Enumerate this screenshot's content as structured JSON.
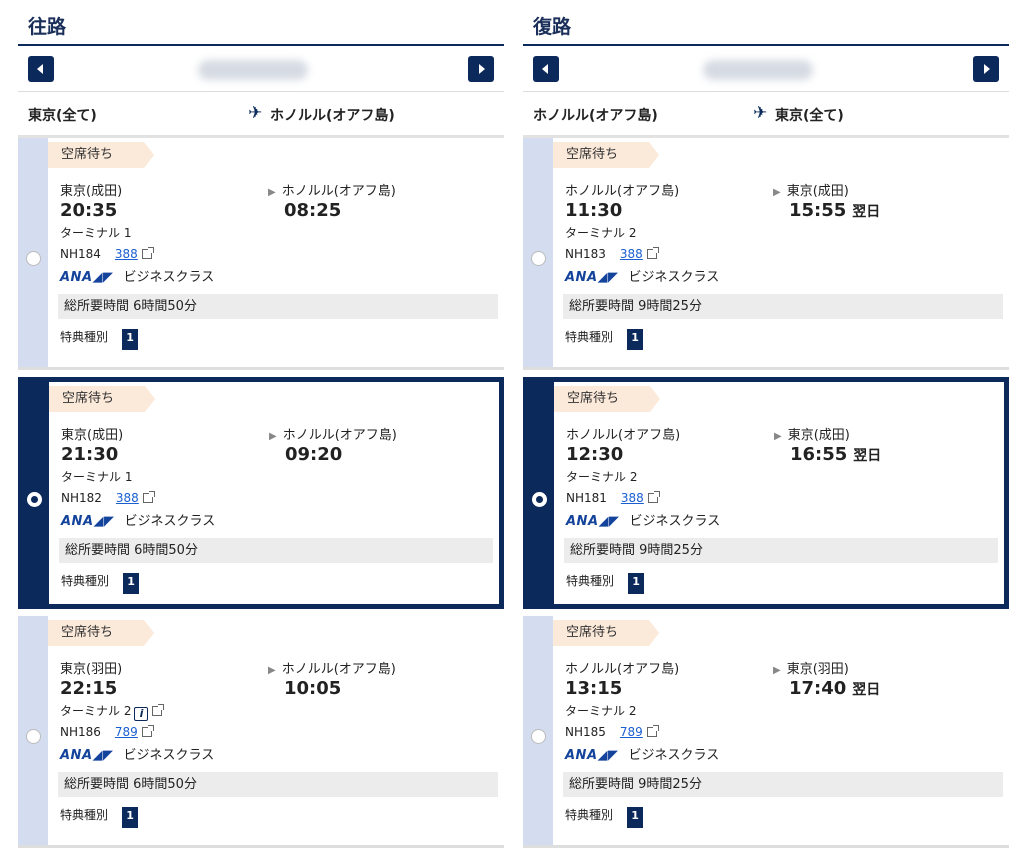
{
  "outbound": {
    "title": "往路",
    "route": {
      "from": "東京(全て)",
      "to": "ホノルル(オアフ島)"
    },
    "flights": [
      {
        "status": "空席待ち",
        "dep_city": "東京(成田)",
        "dep_time": "20:35",
        "arr_city": "ホノルル(オアフ島)",
        "arr_time": "08:25",
        "next_day": "",
        "terminal": "ターミナル 1",
        "flight_no": "NH184",
        "aircraft": "388",
        "cabin": "ビジネスクラス",
        "duration": "総所要時間 6時間50分",
        "award_label": "特典種別",
        "award_value": "1",
        "selected": false
      },
      {
        "status": "空席待ち",
        "dep_city": "東京(成田)",
        "dep_time": "21:30",
        "arr_city": "ホノルル(オアフ島)",
        "arr_time": "09:20",
        "next_day": "",
        "terminal": "ターミナル 1",
        "flight_no": "NH182",
        "aircraft": "388",
        "cabin": "ビジネスクラス",
        "duration": "総所要時間 6時間50分",
        "award_label": "特典種別",
        "award_value": "1",
        "selected": true
      },
      {
        "status": "空席待ち",
        "dep_city": "東京(羽田)",
        "dep_time": "22:15",
        "arr_city": "ホノルル(オアフ島)",
        "arr_time": "10:05",
        "next_day": "",
        "terminal": "ターミナル 2",
        "flight_no": "NH186",
        "aircraft": "789",
        "cabin": "ビジネスクラス",
        "duration": "総所要時間 6時間50分",
        "award_label": "特典種別",
        "award_value": "1",
        "selected": false
      }
    ]
  },
  "return": {
    "title": "復路",
    "route": {
      "from": "ホノルル(オアフ島)",
      "to": "東京(全て)"
    },
    "flights": [
      {
        "status": "空席待ち",
        "dep_city": "ホノルル(オアフ島)",
        "dep_time": "11:30",
        "arr_city": "東京(成田)",
        "arr_time": "15:55",
        "next_day": "翌日",
        "terminal": "ターミナル 2",
        "flight_no": "NH183",
        "aircraft": "388",
        "cabin": "ビジネスクラス",
        "duration": "総所要時間 9時間25分",
        "award_label": "特典種別",
        "award_value": "1",
        "selected": false
      },
      {
        "status": "空席待ち",
        "dep_city": "ホノルル(オアフ島)",
        "dep_time": "12:30",
        "arr_city": "東京(成田)",
        "arr_time": "16:55",
        "next_day": "翌日",
        "terminal": "ターミナル 2",
        "flight_no": "NH181",
        "aircraft": "388",
        "cabin": "ビジネスクラス",
        "duration": "総所要時間 9時間25分",
        "award_label": "特典種別",
        "award_value": "1",
        "selected": true
      },
      {
        "status": "空席待ち",
        "dep_city": "ホノルル(オアフ島)",
        "dep_time": "13:15",
        "arr_city": "東京(羽田)",
        "arr_time": "17:40",
        "next_day": "翌日",
        "terminal": "ターミナル 2",
        "flight_no": "NH185",
        "aircraft": "789",
        "cabin": "ビジネスクラス",
        "duration": "総所要時間 9時間25分",
        "award_label": "特典種別",
        "award_value": "1",
        "selected": false
      }
    ]
  },
  "airline_logo": {
    "text": "ANA",
    "color": "#13439b"
  },
  "icons": {
    "prev": "chevron-left-icon",
    "next": "chevron-right-icon",
    "plane": "airplane-icon",
    "info": "info-icon",
    "external": "external-link-icon"
  },
  "colors": {
    "primary": "#0b2a5b",
    "stripe": "#d4dcf0",
    "tag": "#fbe9d9",
    "link": "#1a5fd0"
  }
}
